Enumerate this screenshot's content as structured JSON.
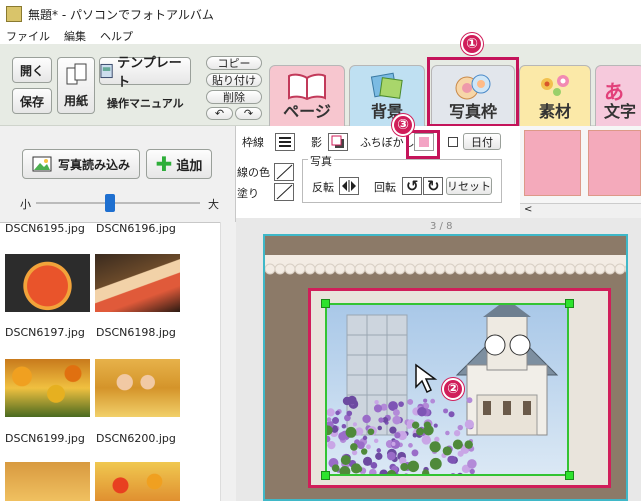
{
  "window": {
    "title": "無題* - パソコンでフォトアルバム"
  },
  "menu": {
    "file": "ファイル",
    "edit": "編集",
    "help": "ヘルプ"
  },
  "ribbon": {
    "open": "開く",
    "save": "保存",
    "paper": "用紙",
    "template": "テンプレート",
    "manual": "操作マニュアル",
    "copy": "コピー",
    "paste": "貼り付け",
    "delete": "削除",
    "undo": "↶",
    "redo": "↷"
  },
  "tabs": [
    {
      "label": "ページ",
      "color": "#f7c6cf"
    },
    {
      "label": "背景",
      "color": "#bfe0f2"
    },
    {
      "label": "写真枠",
      "color": "#d6dbe2",
      "selected": true
    },
    {
      "label": "素材",
      "color": "#fbe9a8"
    },
    {
      "label": "文字",
      "color": "#f6c9dc"
    }
  ],
  "left": {
    "import_photo": "写真読み込み",
    "add": "追加",
    "size_small": "小",
    "size_large": "大",
    "slider_value": 0.45,
    "files": [
      "DSCN6195.jpg",
      "DSCN6196.jpg",
      "DSCN6197.jpg",
      "DSCN6198.jpg",
      "DSCN6199.jpg",
      "DSCN6200.jpg"
    ]
  },
  "props": {
    "border": "枠線",
    "shadow": "影",
    "blur": "ふちぼかし",
    "date": "日付",
    "line_color": "線の色",
    "fill": "塗り",
    "photo_group": "写真",
    "flip": "反転",
    "rotate": "回転",
    "reset": "リセット"
  },
  "canvas": {
    "page_indicator": "3 / 8"
  },
  "callouts": {
    "one": "①",
    "two": "②",
    "three": "③"
  },
  "colors": {
    "accent": "#d01e5a",
    "selection": "#33c433",
    "page_border": "#3fb8c8"
  }
}
